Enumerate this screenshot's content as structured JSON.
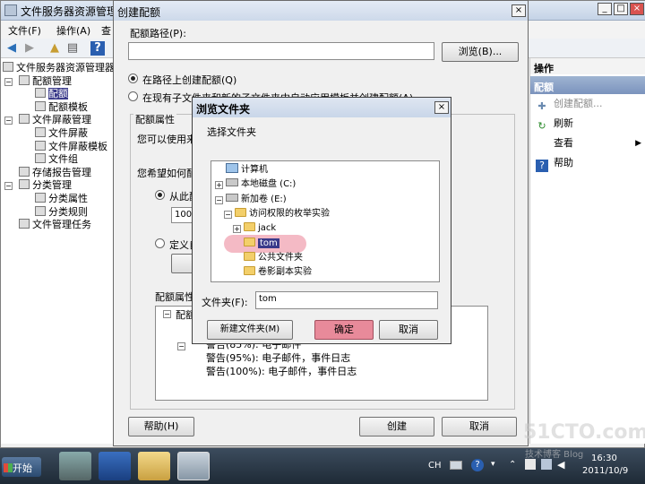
{
  "main_window": {
    "title": "文件服务器资源管理器",
    "menu": [
      "文件(F)",
      "操作(A)",
      "查"
    ],
    "window_buttons": [
      "_",
      "□",
      "×"
    ]
  },
  "tree": {
    "items": [
      {
        "label": "文件服务器资源管理器",
        "level": 0,
        "expander": "",
        "icon": "server-icon"
      },
      {
        "label": "配额管理",
        "level": 1,
        "expander": "−",
        "icon": "quota-icon"
      },
      {
        "label": "配额",
        "level": 2,
        "expander": "",
        "icon": "quota-icon",
        "selected": true
      },
      {
        "label": "配额模板",
        "level": 2,
        "expander": "",
        "icon": "template-icon"
      },
      {
        "label": "文件屏蔽管理",
        "level": 1,
        "expander": "−",
        "icon": "screen-icon"
      },
      {
        "label": "文件屏蔽",
        "level": 2,
        "expander": "",
        "icon": "screen-icon"
      },
      {
        "label": "文件屏蔽模板",
        "level": 2,
        "expander": "",
        "icon": "template-icon"
      },
      {
        "label": "文件组",
        "level": 2,
        "expander": "",
        "icon": "file-group-icon"
      },
      {
        "label": "存储报告管理",
        "level": 1,
        "expander": "",
        "icon": "report-icon"
      },
      {
        "label": "分类管理",
        "level": 1,
        "expander": "−",
        "icon": "classification-icon"
      },
      {
        "label": "分类属性",
        "level": 2,
        "expander": "",
        "icon": "property-icon"
      },
      {
        "label": "分类规则",
        "level": 2,
        "expander": "",
        "icon": "rule-icon"
      },
      {
        "label": "文件管理任务",
        "level": 1,
        "expander": "",
        "icon": "task-icon"
      }
    ]
  },
  "actions": {
    "header": "操作",
    "section": "配额",
    "items": [
      {
        "label": "创建配额...",
        "icon": "create-quota-icon",
        "disabled": true
      },
      {
        "label": "刷新",
        "icon": "refresh-icon"
      },
      {
        "label": "查看",
        "icon": "",
        "arrow": "▶"
      },
      {
        "label": "帮助",
        "icon": "help-icon"
      }
    ]
  },
  "create_quota": {
    "title": "创建配额",
    "close": "×",
    "path_label": "配额路径(P):",
    "path_value": "",
    "browse_button": "浏览(B)...",
    "radio_path": "在路径上创建配额(Q)",
    "radio_template": "在现有子文件夹和新的子文件夹中自动应用模板并创建配额(A)",
    "group_label": "配额属性",
    "group_text_partial": "您可以使用来",
    "question_partial": "您希望如何配",
    "option_from": "从此配",
    "combo_value": "100",
    "option_custom": "定义自",
    "summary_label": "配额属性",
    "summary_root": "配额",
    "summary_lines": [
      "警告(85%): 电子邮件",
      "警告(95%): 电子邮件，事件日志",
      "警告(100%): 电子邮件，事件日志"
    ],
    "help_button": "帮助(H)",
    "create_button": "创建",
    "cancel_button": "取消"
  },
  "browse_dialog": {
    "title": "浏览文件夹",
    "close": "×",
    "prompt": "选择文件夹",
    "nodes": [
      {
        "label": "计算机",
        "type": "pc",
        "expander": ""
      },
      {
        "label": "本地磁盘 (C:)",
        "type": "drive",
        "expander": "+"
      },
      {
        "label": "新加卷 (E:)",
        "type": "drive",
        "expander": "−"
      },
      {
        "label": "访问权限的枚举实验",
        "type": "folder",
        "expander": "−"
      },
      {
        "label": "jack",
        "type": "folder",
        "expander": "+"
      },
      {
        "label": "tom",
        "type": "folder",
        "expander": "",
        "selected": true
      },
      {
        "label": "公共文件夹",
        "type": "folder",
        "expander": ""
      },
      {
        "label": "卷影副本实验",
        "type": "folder",
        "expander": ""
      }
    ],
    "folder_label": "文件夹(F):",
    "folder_value": "tom",
    "new_folder_button": "新建文件夹(M)",
    "ok_button": "确定",
    "cancel_button": "取消"
  },
  "taskbar": {
    "start": "开始",
    "ime": "CH",
    "time": "16:30",
    "date": "2011/10/9"
  },
  "watermark": {
    "main": "51CTO.com",
    "sub": "技术博客 Blog"
  },
  "colors": {
    "title_bar": "#cdd9ea",
    "selection": "#3a3a8a",
    "ok_highlight": "#e88a9a",
    "action_section": "#7b93bd"
  }
}
